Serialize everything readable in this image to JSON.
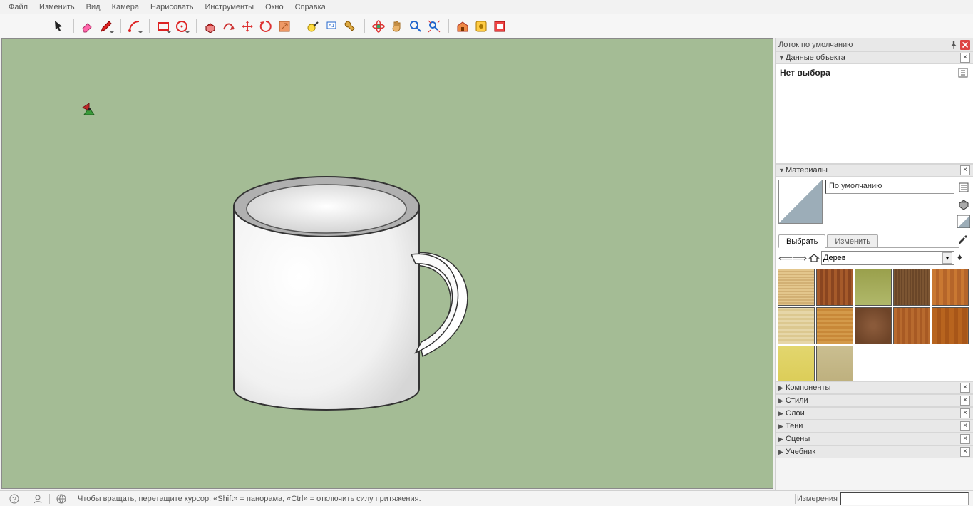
{
  "menubar": [
    "Файл",
    "Изменить",
    "Вид",
    "Камера",
    "Нарисовать",
    "Инструменты",
    "Окно",
    "Справка"
  ],
  "toolbar": [
    {
      "name": "select-tool",
      "dd": false
    },
    {
      "sep": true
    },
    {
      "name": "eraser-tool",
      "dd": false
    },
    {
      "name": "pencil-tool",
      "dd": true
    },
    {
      "sep": true
    },
    {
      "name": "arc-tool",
      "dd": true
    },
    {
      "sep": true
    },
    {
      "name": "rectangle-tool",
      "dd": true
    },
    {
      "name": "circle-tool",
      "dd": true
    },
    {
      "sep": true
    },
    {
      "name": "pushpull-tool",
      "dd": false
    },
    {
      "name": "followme-tool",
      "dd": false
    },
    {
      "name": "move-tool",
      "dd": false
    },
    {
      "name": "rotate-tool",
      "dd": false
    },
    {
      "name": "scale-tool",
      "dd": false
    },
    {
      "sep": true
    },
    {
      "name": "tape-tool",
      "dd": false
    },
    {
      "name": "text-tool",
      "dd": false
    },
    {
      "name": "paint-tool",
      "dd": false
    },
    {
      "sep": true
    },
    {
      "name": "orbit-tool",
      "dd": false
    },
    {
      "name": "pan-tool",
      "dd": false
    },
    {
      "name": "zoom-tool",
      "dd": false
    },
    {
      "name": "zoom-extents-tool",
      "dd": false
    },
    {
      "sep": true
    },
    {
      "name": "warehouse-tool",
      "dd": false
    },
    {
      "name": "extensions-tool",
      "dd": false
    },
    {
      "name": "layout-tool",
      "dd": false
    }
  ],
  "status": {
    "hint": "Чтобы вращать, перетащите курсор. «Shift» = панорама, «Ctrl» = отключить силу притяжения.",
    "measurements_label": "Измерения"
  },
  "sidebar": {
    "tray_title": "Лоток по умолчанию",
    "entity": {
      "title": "Данные объекта",
      "no_selection": "Нет выбора"
    },
    "materials": {
      "title": "Материалы",
      "current_name": "По умолчанию",
      "tab_select": "Выбрать",
      "tab_edit": "Изменить",
      "library": "Дерев",
      "thumbs": [
        "th1",
        "th2",
        "th3",
        "th4",
        "th5",
        "th6",
        "th7",
        "th8",
        "th9",
        "th10",
        "th11",
        "th12"
      ]
    },
    "collapsed": [
      "Компоненты",
      "Стили",
      "Слои",
      "Тени",
      "Сцены",
      "Учебник"
    ]
  }
}
